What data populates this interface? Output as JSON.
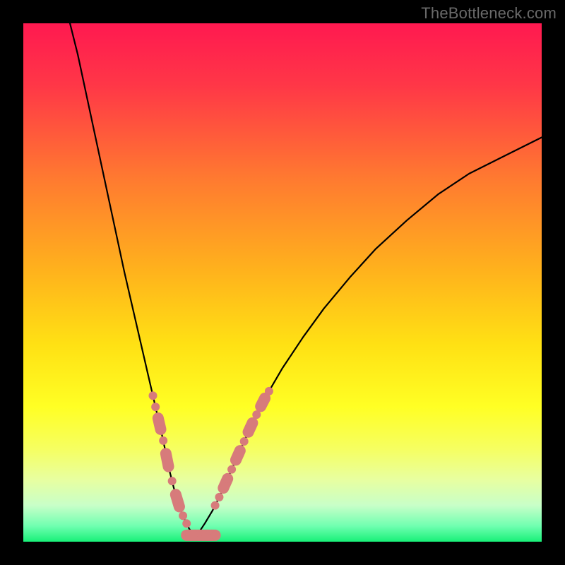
{
  "watermark": {
    "text": "TheBottleneck.com"
  },
  "bg_gradient": {
    "stops": [
      {
        "pct": 0,
        "color": "#ff1950"
      },
      {
        "pct": 12,
        "color": "#ff3747"
      },
      {
        "pct": 30,
        "color": "#ff7a30"
      },
      {
        "pct": 48,
        "color": "#ffb31c"
      },
      {
        "pct": 62,
        "color": "#ffe114"
      },
      {
        "pct": 74,
        "color": "#ffff24"
      },
      {
        "pct": 82,
        "color": "#f6ff60"
      },
      {
        "pct": 88,
        "color": "#e8ffa0"
      },
      {
        "pct": 93,
        "color": "#c8ffc8"
      },
      {
        "pct": 97,
        "color": "#6fffb0"
      },
      {
        "pct": 100,
        "color": "#18f078"
      }
    ]
  },
  "curve_style": {
    "stroke": "#000000",
    "width": 2.2
  },
  "beads": {
    "fill": "#d77b7b",
    "stroke": "#d77b7b",
    "r_dot": 6,
    "r_cap": 8
  },
  "chart_data": {
    "type": "line",
    "title": "",
    "xlabel": "",
    "ylabel": "",
    "x_range": [
      0,
      100
    ],
    "y_range": [
      0,
      100
    ],
    "series": [
      {
        "name": "left-curve",
        "x": [
          9.0,
          10.5,
          12.0,
          13.5,
          15.0,
          16.5,
          18.0,
          19.5,
          21.0,
          22.5,
          24.0,
          25.5,
          27.0,
          28.0,
          29.0,
          30.0,
          31.0,
          32.0,
          33.0
        ],
        "y": [
          100.0,
          94.0,
          87.0,
          80.0,
          73.0,
          66.0,
          59.0,
          52.0,
          45.5,
          39.0,
          32.5,
          26.0,
          19.5,
          14.5,
          10.5,
          7.0,
          4.5,
          2.5,
          1.2
        ]
      },
      {
        "name": "right-curve",
        "x": [
          33.0,
          34.0,
          35.0,
          36.5,
          38.0,
          40.0,
          42.0,
          44.0,
          46.5,
          50.0,
          54.0,
          58.0,
          63.0,
          68.0,
          74.0,
          80.0,
          86.0,
          93.0,
          100.0
        ],
        "y": [
          1.2,
          2.0,
          3.5,
          6.0,
          9.0,
          13.5,
          18.0,
          22.5,
          27.5,
          33.5,
          39.5,
          45.0,
          51.0,
          56.5,
          62.0,
          67.0,
          71.0,
          74.5,
          78.0
        ]
      }
    ],
    "bead_segments": [
      {
        "on": "left-curve",
        "x": [
          25.0,
          25.5,
          26.0,
          26.5,
          27.0,
          27.5,
          28.0,
          28.7,
          29.4,
          30.1,
          30.8,
          31.5
        ]
      },
      {
        "on": "right-curve",
        "x": [
          37.0,
          37.8,
          38.6,
          39.4,
          40.2,
          41.0,
          41.8,
          42.6,
          43.4,
          44.2,
          45.0,
          45.8,
          46.6,
          47.4
        ]
      }
    ],
    "trough": {
      "x": [
        31.5,
        32.3,
        33.1,
        33.9,
        34.7,
        35.5,
        36.3,
        37.0
      ],
      "y": 1.25
    }
  }
}
